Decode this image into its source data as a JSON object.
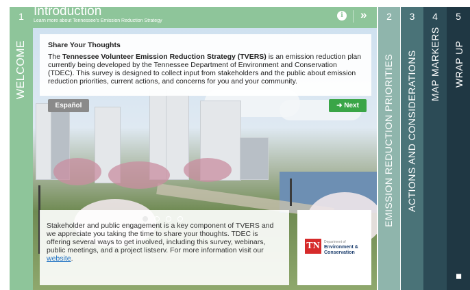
{
  "steps": [
    {
      "number": "1",
      "label": "WELCOME"
    },
    {
      "number": "2",
      "label": "EMISSION REDUCTION PRIORITIES"
    },
    {
      "number": "3",
      "label": "ACTIONS AND CONSIDERATIONS"
    },
    {
      "number": "4",
      "label": "MAP MARKERS"
    },
    {
      "number": "5",
      "label": "WRAP UP"
    }
  ],
  "header": {
    "title": "Introduction",
    "subtitle": "Learn more about Tennessee's Emission Reduction Strategy",
    "info_icon": "info-icon",
    "collapse_icon": "double-chevron-right-icon"
  },
  "card_top": {
    "heading": "Share Your Thoughts",
    "text_before": "The ",
    "text_bold": "Tennessee Volunteer Emission Reduction Strategy (TVERS)",
    "text_after": " is an emission reduction plan currently being developed by the Tennessee Department of Environment and Conservation (TDEC). This survey is designed to collect input from stakeholders and the public about emission reduction priorities, current actions, and concerns for you and your community."
  },
  "buttons": {
    "espanol": "Español",
    "next": "➜ Next"
  },
  "carousel": {
    "slides": 4,
    "active_index": 0
  },
  "card_bottom": {
    "text": "Stakeholder and public engagement is a key component of TVERS and we appreciate you taking the time to share your thoughts. TDEC is offering several ways to get involved, including this survey, webinars, public meetings, and a project listserv. For more information visit our ",
    "link": "website",
    "end": "."
  },
  "logo": {
    "tn": "TN",
    "dept": "Department of",
    "line1": "Environment &",
    "line2": "Conservation"
  },
  "share_icon": "share-icon",
  "colors": {
    "step1_green": "#8ec59a",
    "step2": "#8fb5ac",
    "step3": "#4a7378",
    "step4": "#2c4b56",
    "step5": "#1f3743",
    "next_button": "#3aa547",
    "espanol_button": "#8a8a8a",
    "tn_red": "#d62b2b"
  }
}
